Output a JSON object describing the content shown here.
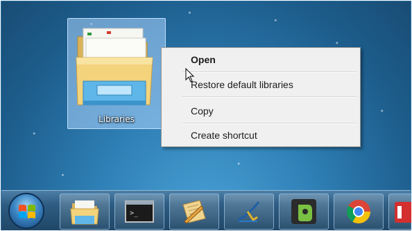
{
  "desktop": {
    "library_icon_label": "Libraries"
  },
  "context_menu": {
    "items": [
      {
        "label": "Open",
        "bold": true
      },
      {
        "label": "Restore default libraries",
        "bold": false
      },
      {
        "label": "Copy",
        "bold": false
      },
      {
        "label": "Create shortcut",
        "bold": false
      }
    ]
  },
  "taskbar": {
    "start_icon": "windows-start-orb",
    "pinned_icons": [
      "folder-library-icon",
      "command-prompt-icon",
      "notepad-pencil-icon",
      "visual-studio-icon",
      "evernote-icon",
      "chrome-icon",
      "red-app-icon"
    ]
  },
  "colors": {
    "menu_background": "#f0f0f0",
    "selection_highlight": "#add6ff",
    "taskbar": "#2e5c82"
  }
}
